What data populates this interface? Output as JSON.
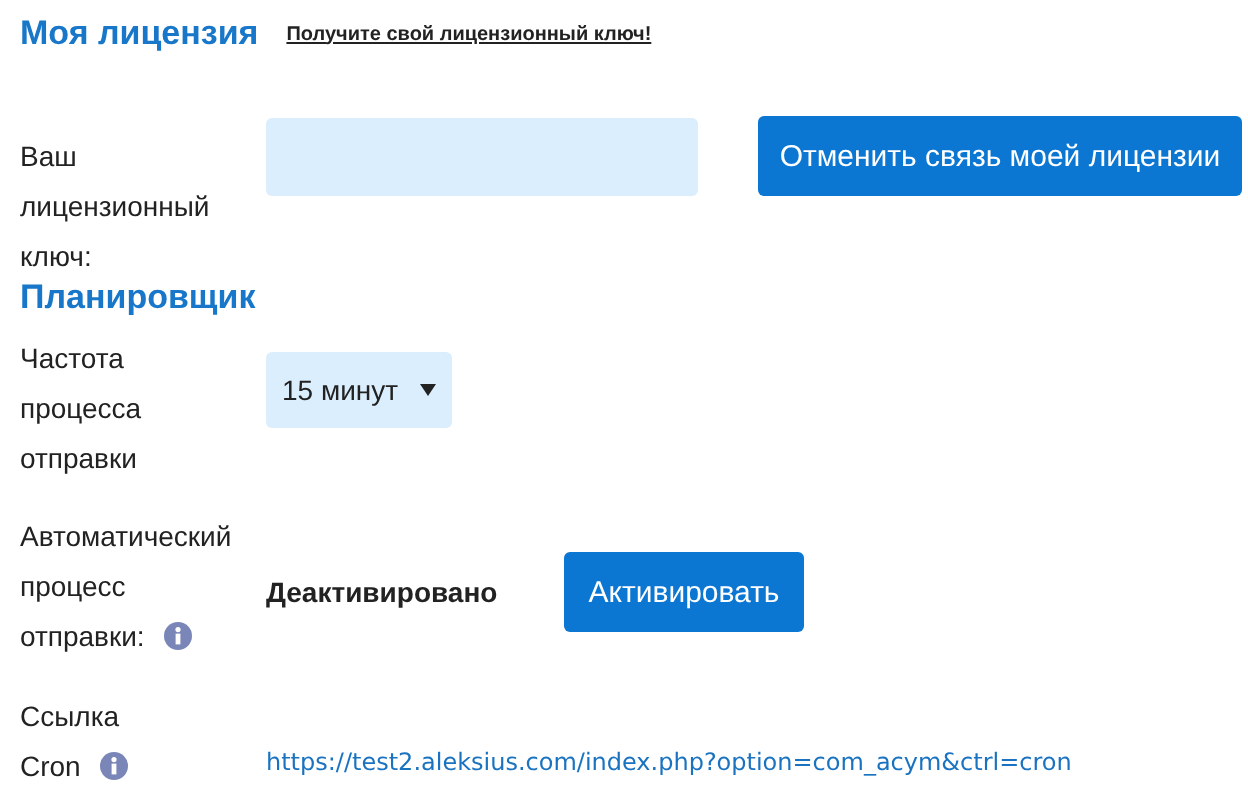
{
  "sections": [
    {
      "title": "Моя лицензия",
      "link": "Получите свой лицензионный ключ!",
      "rows": [
        {
          "kind": "input",
          "label_lines": [
            "Ваш",
            "лицензионный",
            "ключ:"
          ],
          "info": false,
          "button": "Отменить связь моей лицензии"
        }
      ]
    },
    {
      "title": "Планировщик",
      "rows": [
        {
          "kind": "select",
          "label_lines": [
            "Частота",
            "процесса",
            "отправки"
          ],
          "info": false,
          "value": "15 минут"
        },
        {
          "kind": "status",
          "label_lines": [
            "Автоматический",
            "процесс",
            "отправки:"
          ],
          "info": true,
          "status": "Деактивировано",
          "button": "Активировать"
        },
        {
          "kind": "link",
          "label_lines": [
            "Ссылка",
            "Cron"
          ],
          "info": true,
          "url": "https://test2.aleksius.com/index.php?option=com_acym&ctrl=cron"
        }
      ]
    }
  ]
}
